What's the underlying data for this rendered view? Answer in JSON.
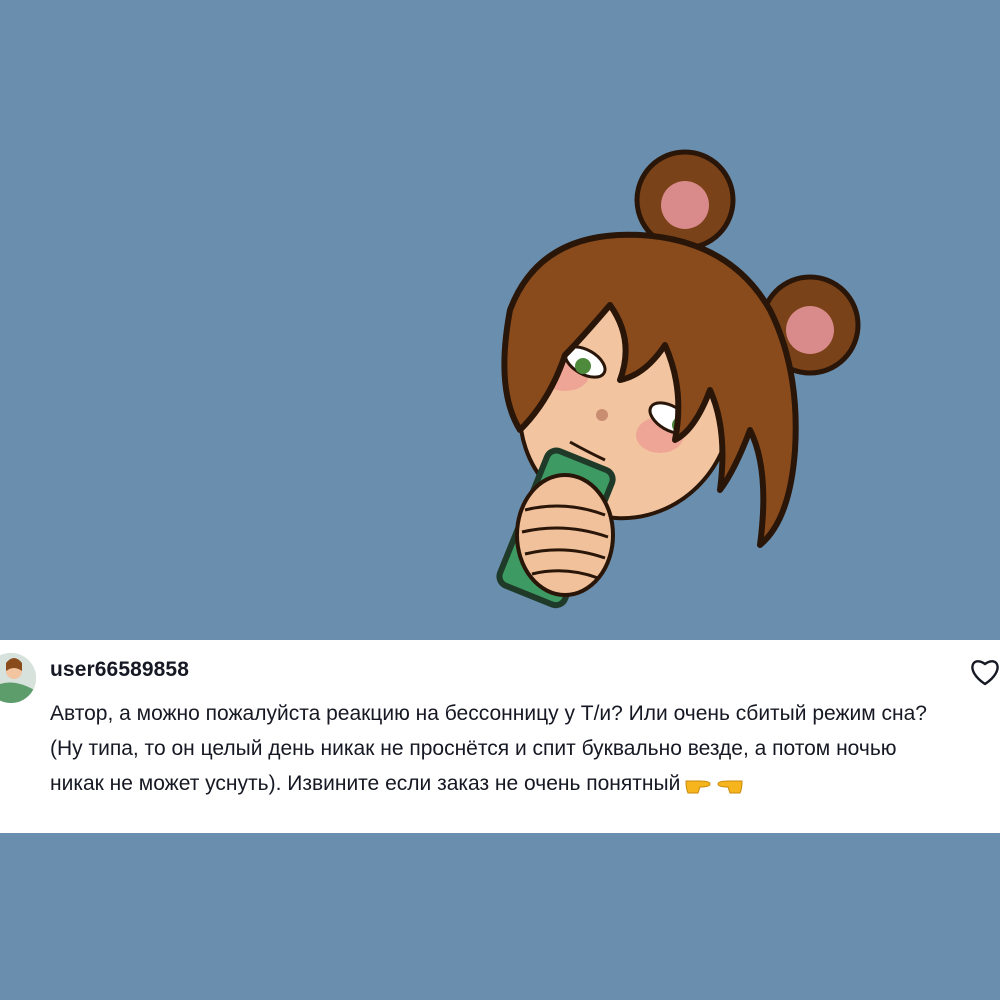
{
  "comment": {
    "username": "user66589858",
    "text": "Автор, а можно пожалуйста реакцию на бессонницу у Т/и? Или очень сбитый режим сна? (Ну типа, то он целый день никак не проснётся и спит буквально везде, а потом ночью никак не может уснуть). Извините если заказ не очень понятный",
    "emoji": [
      "pointing-right-hand",
      "pointing-left-hand"
    ]
  },
  "icons": {
    "like": "heart-outline-icon",
    "avatar": "avatar"
  },
  "colors": {
    "background": "#6a8eae",
    "card": "#ffffff",
    "text": "#161823",
    "hair": "#8a4b1c",
    "phone": "#3e9a63"
  }
}
